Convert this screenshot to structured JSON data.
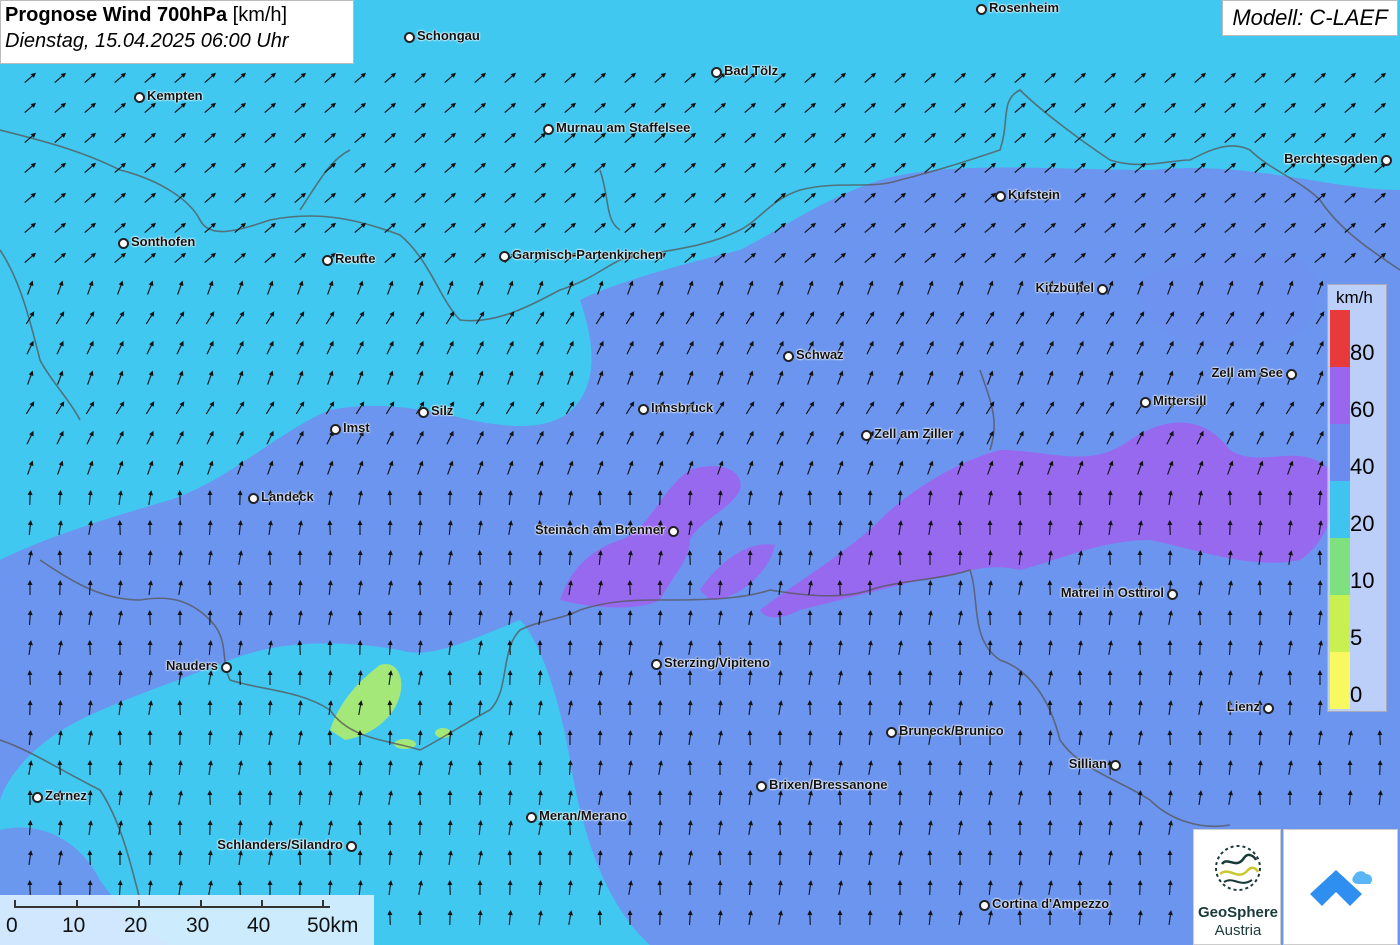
{
  "header": {
    "title_bold": "Prognose Wind 700hPa",
    "title_unit": "[km/h]",
    "subtitle": "Dienstag, 15.04.2025 06:00 Uhr",
    "model": "Modell: C-LAEF"
  },
  "legend": {
    "unit": "km/h",
    "ticks": [
      "80",
      "60",
      "40",
      "20",
      "10",
      "5",
      "0"
    ],
    "colors": [
      "#e83a3a",
      "#9a66ee",
      "#6a8cf0",
      "#3ec4ee",
      "#7ee07e",
      "#c8f050",
      "#f8f860"
    ]
  },
  "scale_bar": {
    "labels": [
      "0",
      "10",
      "20",
      "30",
      "40",
      "50km"
    ]
  },
  "logos": {
    "geosphere_line1": "GeoSphere",
    "geosphere_line2": "Austria"
  },
  "cities": [
    {
      "name": "Rosenheim"
    },
    {
      "name": "Schongau"
    },
    {
      "name": "Bad Tölz"
    },
    {
      "name": "Kempten"
    },
    {
      "name": "Murnau am Staffelsee"
    },
    {
      "name": "Berchtesgaden"
    },
    {
      "name": "Kufstein"
    },
    {
      "name": "Sonthofen"
    },
    {
      "name": "Reutte"
    },
    {
      "name": "Garmisch-Partenkirchen"
    },
    {
      "name": "Kitzbühel"
    },
    {
      "name": "Schwaz"
    },
    {
      "name": "Zell am See"
    },
    {
      "name": "Mittersill"
    },
    {
      "name": "Silz"
    },
    {
      "name": "Innsbruck"
    },
    {
      "name": "Imst"
    },
    {
      "name": "Zell am Ziller"
    },
    {
      "name": "Landeck"
    },
    {
      "name": "Steinach am Brenner"
    },
    {
      "name": "Matrei in Osttirol"
    },
    {
      "name": "Nauders"
    },
    {
      "name": "Sterzing/Vipiteno"
    },
    {
      "name": "Lienz"
    },
    {
      "name": "Bruneck/Brunico"
    },
    {
      "name": "Sillian"
    },
    {
      "name": "Brixen/Bressanone"
    },
    {
      "name": "Zernez"
    },
    {
      "name": "Meran/Merano"
    },
    {
      "name": "Schlanders/Silandro"
    },
    {
      "name": "Cortina d'Ampezzo"
    }
  ]
}
